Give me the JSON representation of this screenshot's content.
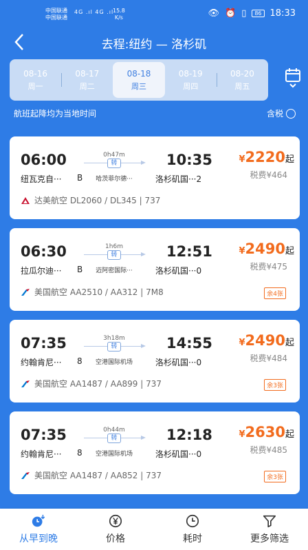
{
  "status_bar": {
    "carrier_1": "中国联通",
    "carrier_2": "中国联通",
    "signal_1": "4G .ıl",
    "signal_2": "4G .ıl",
    "speed_value": "15.8",
    "speed_unit": "K/s",
    "battery": "86",
    "time": "18:33"
  },
  "header": {
    "title": "去程:纽约 — 洛杉矶"
  },
  "date_tabs": [
    {
      "date": "08-16",
      "dow": "周一"
    },
    {
      "date": "08-17",
      "dow": "周二"
    },
    {
      "date": "08-18",
      "dow": "周三",
      "selected": true
    },
    {
      "date": "08-19",
      "dow": "周四"
    },
    {
      "date": "08-20",
      "dow": "周五"
    }
  ],
  "subbar": {
    "note": "航班起降均为当地时间",
    "tax_label": "含税"
  },
  "flights": [
    {
      "dep_time": "06:00",
      "arr_time": "10:35",
      "dep_airport": "纽瓦克自···",
      "dep_terminal": "B",
      "arr_airport": "洛杉矶国···2",
      "duration": "0h47m",
      "stop_badge": "转",
      "stop_city": "哈茨菲尔德···",
      "price_symbol": "¥",
      "price": "2220",
      "price_suffix": "起",
      "tax": "税费¥464",
      "airline": "达美航空 DL2060 / DL345 | 737",
      "logo": "delta-logo",
      "seats": ""
    },
    {
      "dep_time": "06:30",
      "arr_time": "12:51",
      "dep_airport": "拉瓜尔迪···",
      "dep_terminal": "B",
      "arr_airport": "洛杉矶国···0",
      "duration": "1h6m",
      "stop_badge": "转",
      "stop_city": "迈阿密国际···",
      "price_symbol": "¥",
      "price": "2490",
      "price_suffix": "起",
      "tax": "税费¥475",
      "airline": "美国航空 AA2510 / AA312 | 7M8",
      "logo": "american-logo",
      "seats": "余4张"
    },
    {
      "dep_time": "07:35",
      "arr_time": "14:55",
      "dep_airport": "约翰肯尼···",
      "dep_terminal": "8",
      "arr_airport": "洛杉矶国···0",
      "duration": "3h18m",
      "stop_badge": "转",
      "stop_city": "空港国际机场",
      "price_symbol": "¥",
      "price": "2490",
      "price_suffix": "起",
      "tax": "税费¥484",
      "airline": "美国航空 AA1487 / AA899 | 737",
      "logo": "american-logo",
      "seats": "余3张"
    },
    {
      "dep_time": "07:35",
      "arr_time": "12:18",
      "dep_airport": "约翰肯尼···",
      "dep_terminal": "8",
      "arr_airport": "洛杉矶国···0",
      "duration": "0h44m",
      "stop_badge": "转",
      "stop_city": "空港国际机场",
      "price_symbol": "¥",
      "price": "2630",
      "price_suffix": "起",
      "tax": "税费¥485",
      "airline": "美国航空 AA1487 / AA852 | 737",
      "logo": "american-logo",
      "seats": "余3张"
    }
  ],
  "bottom_bar": {
    "items": [
      {
        "label": "从早到晚",
        "icon": "clock-sort-icon",
        "active": true
      },
      {
        "label": "价格",
        "icon": "yen-icon"
      },
      {
        "label": "耗时",
        "icon": "clock-icon"
      },
      {
        "label": "更多筛选",
        "icon": "filter-icon"
      }
    ]
  },
  "colors": {
    "primary": "#2e7ce6",
    "price": "#f26b1d"
  }
}
